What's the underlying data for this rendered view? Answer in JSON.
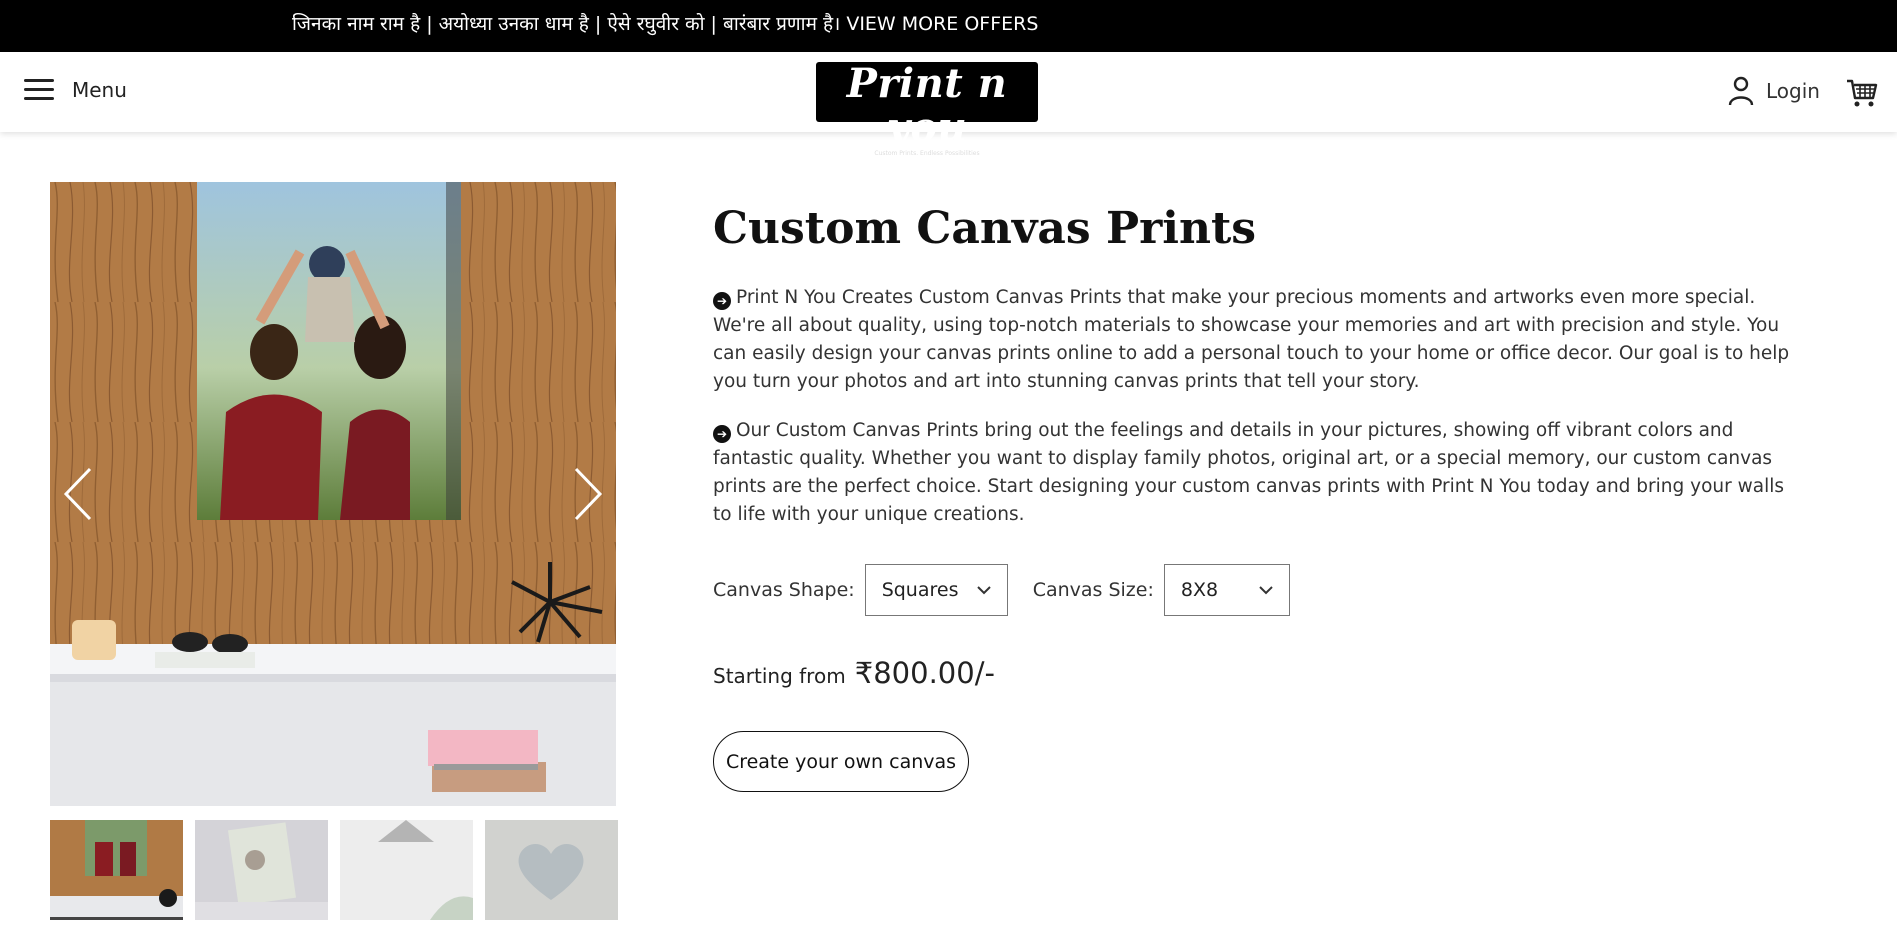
{
  "topbar": {
    "offer_text": "जिनका नाम राम है | अयोध्या उनका धाम है | ऐसे रघुवीर को | बारंबार प्रणाम है। VIEW MORE OFFERS"
  },
  "header": {
    "menu_label": "Menu",
    "logo_text": "Print n you",
    "logo_tagline": "Custom Prints. Endless Possibilities",
    "login_label": "Login"
  },
  "product": {
    "title": "Custom Canvas Prints",
    "paragraphs": [
      "Print N You Creates Custom Canvas Prints that make your precious moments and artworks even more special. We're all about quality, using top-notch materials to showcase your memories and art with precision and style. You can easily design your canvas prints online to add a personal touch to your home or office decor. Our goal is to help you turn your photos and art into stunning canvas prints that tell your story.",
      "Our Custom Canvas Prints bring out the feelings and details in your pictures, showing off vibrant colors and fantastic quality. Whether you want to display family photos, original art, or a special memory, our custom canvas prints are the perfect choice. Start designing your custom canvas prints with Print N You today and bring your walls to life with your unique creations."
    ],
    "shape_label": "Canvas Shape:",
    "shape_value": "Squares",
    "size_label": "Canvas Size:",
    "size_value": "8X8",
    "price_lead": "Starting from",
    "price_value": "₹800.00/-",
    "cta_label": "Create your own canvas"
  },
  "gallery": {
    "thumbnail_count": 4,
    "active_index": 0
  },
  "colors": {
    "topbar_bg": "#000000",
    "wood": "#b07a45",
    "shelf": "#f2f3f5"
  }
}
